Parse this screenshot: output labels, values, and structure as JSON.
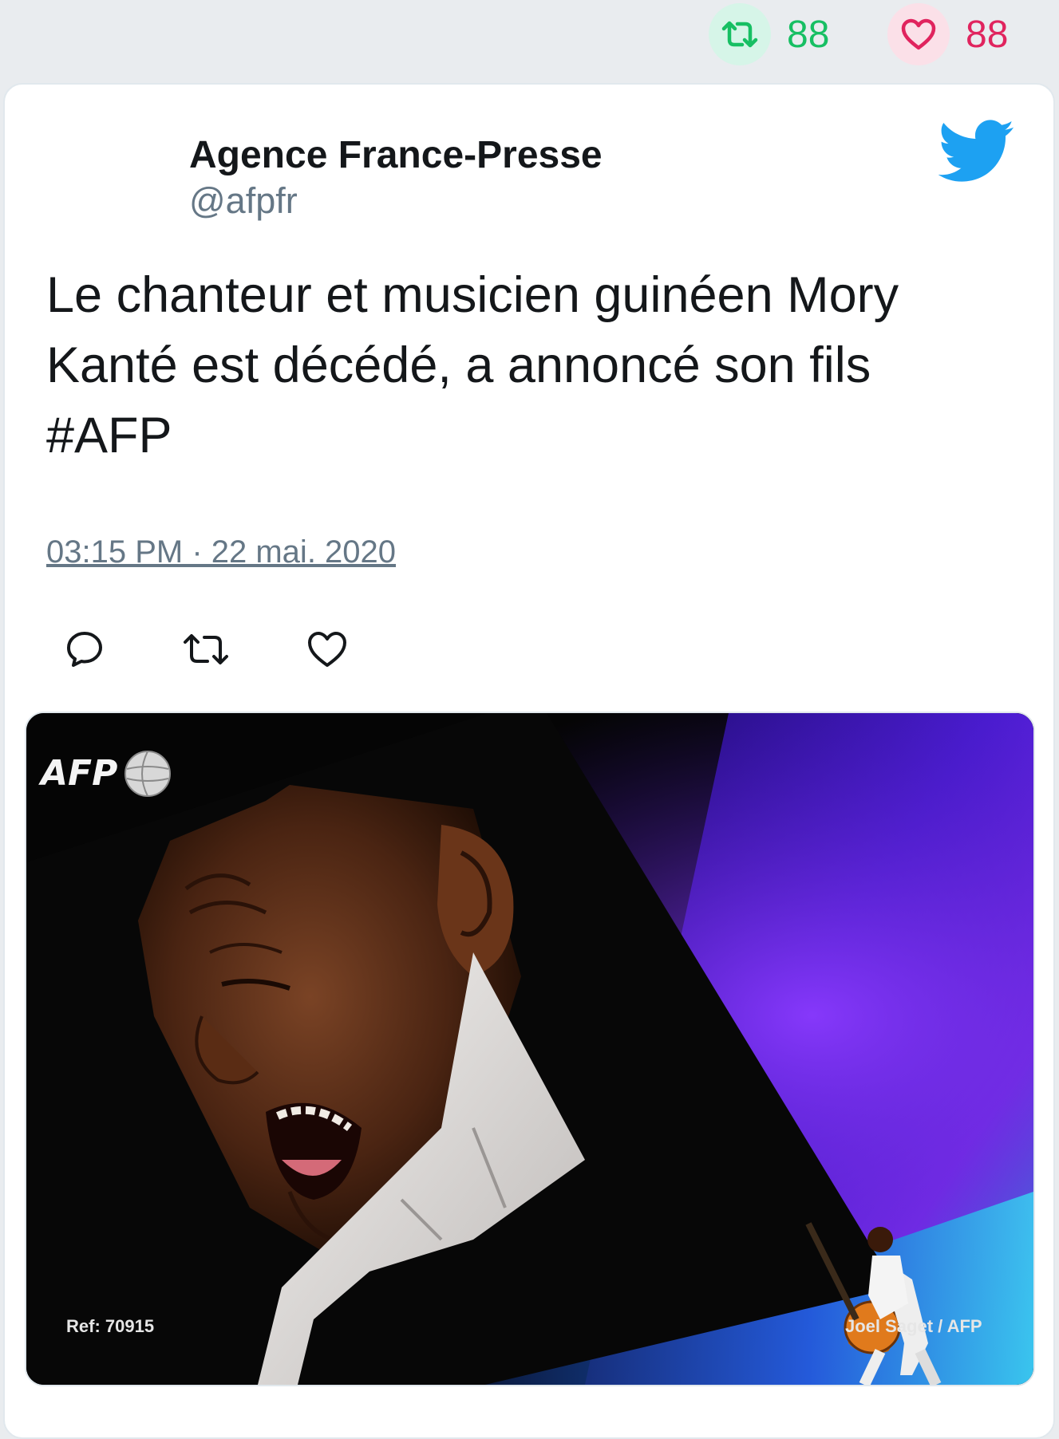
{
  "top_stats": {
    "retweet_count": "88",
    "like_count": "88"
  },
  "tweet": {
    "author_name": "Agence France-Presse",
    "author_handle": "@afpfr",
    "text": "Le chanteur et musicien guinéen Mory\nKanté est décédé, a annoncé son fils\n#AFP",
    "timestamp": "03:15 PM · 22 mai. 2020"
  },
  "media": {
    "logo_text": "AFP",
    "ref_text": "Ref: 70915",
    "credit_text": "Joel Saget / AFP"
  },
  "icons": {
    "twitter": "twitter-bird-icon",
    "reply": "reply-icon",
    "retweet": "retweet-icon",
    "like": "heart-icon"
  },
  "colors": {
    "retweet_green": "#17bf63",
    "like_red": "#e0245e",
    "twitter_blue": "#1da1f2",
    "text_dark": "#14171a",
    "text_muted": "#657786"
  }
}
